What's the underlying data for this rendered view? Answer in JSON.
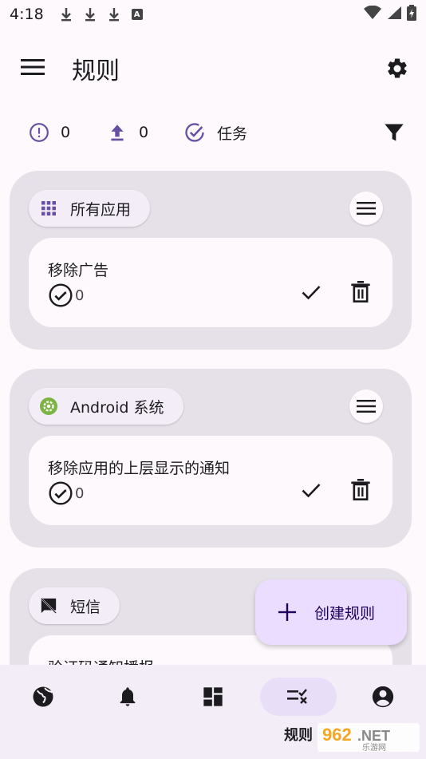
{
  "status_bar": {
    "time": "4:18",
    "notification_icons": [
      "download-icon",
      "download-icon",
      "download-icon",
      "text-badge-icon"
    ],
    "text_badge": "A",
    "right_icons": [
      "wifi-icon",
      "signal-icon",
      "battery-icon"
    ]
  },
  "app_bar": {
    "title": "规则",
    "menu_icon": "menu-icon",
    "settings_icon": "gear-icon"
  },
  "stats": {
    "errors": {
      "icon": "alert-circle-icon",
      "value": "0"
    },
    "uploads": {
      "icon": "upload-icon",
      "value": "0"
    },
    "tasks": {
      "icon": "check-circle-icon",
      "label": "任务"
    },
    "filter_icon": "filter-icon"
  },
  "groups": [
    {
      "chip_label": "所有应用",
      "chip_icon": "apps-grid-icon",
      "rules": [
        {
          "title": "移除广告",
          "count": "0"
        }
      ]
    },
    {
      "chip_label": "Android 系统",
      "chip_icon": "android-settings-icon",
      "rules": [
        {
          "title": "移除应用的上层显示的通知",
          "count": "0"
        }
      ]
    },
    {
      "chip_label": "短信",
      "chip_icon": "sms-off-icon",
      "rules": [
        {
          "title": "验证码通知播报",
          "count": ""
        }
      ]
    }
  ],
  "fab": {
    "label": "创建规则",
    "icon": "plus-icon"
  },
  "bottom_nav": {
    "items": [
      {
        "icon": "globe-icon",
        "label": ""
      },
      {
        "icon": "bell-icon",
        "label": ""
      },
      {
        "icon": "dashboard-icon",
        "label": ""
      },
      {
        "icon": "rules-icon",
        "label": "规则",
        "active": true
      },
      {
        "icon": "account-icon",
        "label": ""
      }
    ]
  },
  "watermark": {
    "text": "962.NET",
    "subtext": "乐游网"
  },
  "colors": {
    "background": "#fdf9fc",
    "group_bg": "#e6e0e9",
    "primary": "#6750a4",
    "fab_bg": "#eaddff",
    "nav_active": "#e8def8"
  }
}
